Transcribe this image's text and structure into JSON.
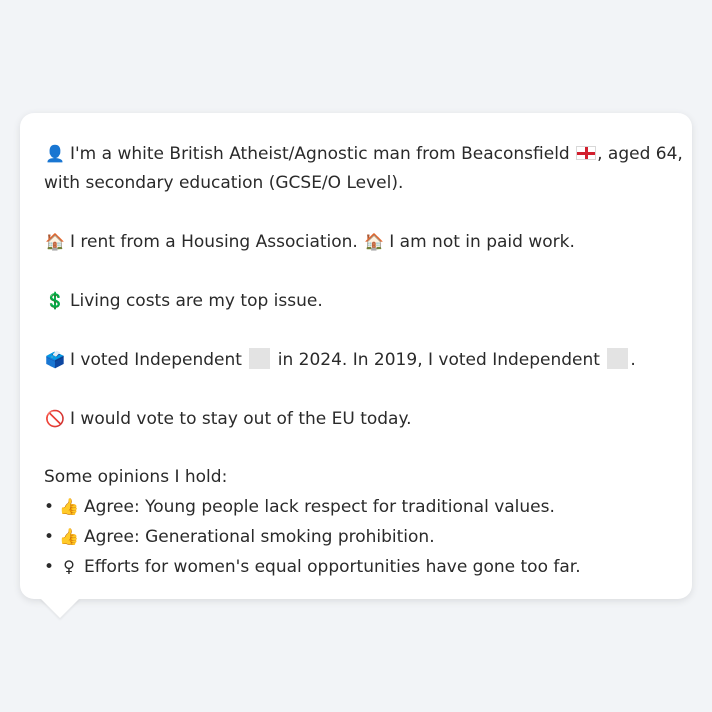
{
  "profile": {
    "line1_icon": "👤",
    "line1_text_a": "I'm a white British Atheist/Agnostic man from Beaconsfield",
    "line1_flag": "england-flag-icon",
    "line1_text_b": ", aged 64,",
    "line2_text": "with secondary education (GCSE/O Level).",
    "housing_icon": "🏠",
    "housing_text": "I rent from a Housing Association.",
    "work_icon": "🏠",
    "work_text": "I am not in paid work.",
    "issue_icon": "💲",
    "issue_text": "Living costs are my top issue.",
    "vote_icon": "🗳️",
    "vote_text_a": "I voted Independent",
    "vote_text_b": "in 2024. In 2019, I voted Independent",
    "vote_text_c": ".",
    "eu_icon": "🚫",
    "eu_text": "I would vote to stay out of the EU today.",
    "opinions_heading": "Some opinions I hold:",
    "opinions": [
      {
        "bullet": "•",
        "icon": "👍",
        "text": "Agree: Young people lack respect for traditional values."
      },
      {
        "bullet": "•",
        "icon": "👍",
        "text": "Agree: Generational smoking prohibition."
      },
      {
        "bullet": "•",
        "icon": "♀",
        "text": "Efforts for women's equal opportunities have gone too far."
      }
    ]
  },
  "colors": {
    "background": "#f2f4f7",
    "bubble": "#ffffff",
    "text": "#2a2a2a",
    "party_swatch": "#e3e3e3"
  }
}
